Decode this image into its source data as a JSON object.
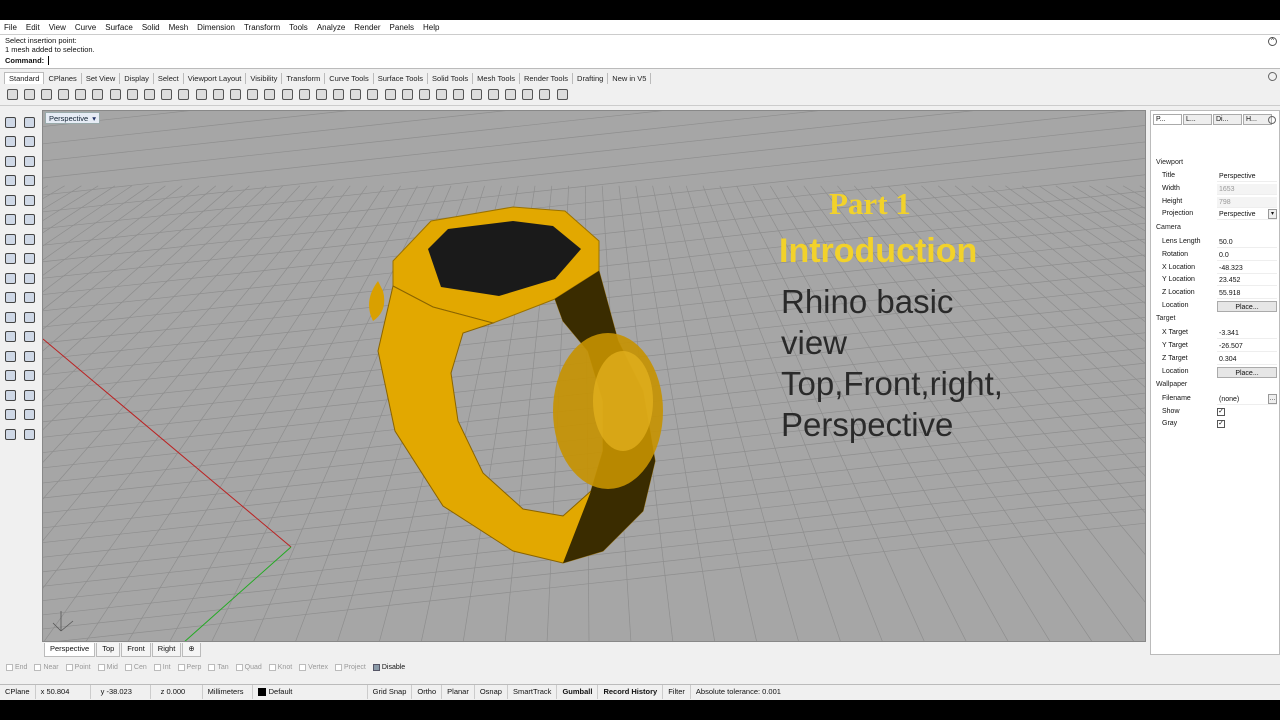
{
  "menu": [
    "File",
    "Edit",
    "View",
    "Curve",
    "Surface",
    "Solid",
    "Mesh",
    "Dimension",
    "Transform",
    "Tools",
    "Analyze",
    "Render",
    "Panels",
    "Help"
  ],
  "command": {
    "line1": "Select insertion point:",
    "line2": "1 mesh added to selection.",
    "prompt": "Command:"
  },
  "toolbar_tabs": [
    "Standard",
    "CPlanes",
    "Set View",
    "Display",
    "Select",
    "Viewport Layout",
    "Visibility",
    "Transform",
    "Curve Tools",
    "Surface Tools",
    "Solid Tools",
    "Mesh Tools",
    "Render Tools",
    "Drafting",
    "New in V5"
  ],
  "viewport": {
    "title": "Perspective",
    "dropdown_icon": "chevron-down-icon"
  },
  "overlay": {
    "part": "Part 1",
    "heading": "Introduction",
    "body_lines": [
      "Rhino basic",
      "view",
      "Top,Front,right,",
      "Perspective"
    ]
  },
  "viewport_tabs": [
    "Perspective",
    "Top",
    "Front",
    "Right"
  ],
  "osnaps": [
    {
      "label": "End",
      "on": false
    },
    {
      "label": "Near",
      "on": false
    },
    {
      "label": "Point",
      "on": false
    },
    {
      "label": "Mid",
      "on": false
    },
    {
      "label": "Cen",
      "on": false
    },
    {
      "label": "Int",
      "on": false
    },
    {
      "label": "Perp",
      "on": false
    },
    {
      "label": "Tan",
      "on": false
    },
    {
      "label": "Quad",
      "on": false
    },
    {
      "label": "Knot",
      "on": false
    },
    {
      "label": "Vertex",
      "on": false
    },
    {
      "label": "Project",
      "on": false
    },
    {
      "label": "Disable",
      "on": true
    }
  ],
  "status": {
    "cplane": "CPlane",
    "x": "x 50.804",
    "y": "y -38.023",
    "z": "z 0.000",
    "units": "Millimeters",
    "layer": "Default",
    "grid_snap": "Grid Snap",
    "ortho": "Ortho",
    "planar": "Planar",
    "osnap": "Osnap",
    "smarttrack": "SmartTrack",
    "gumball": "Gumball",
    "record": "Record History",
    "filter": "Filter",
    "tolerance": "Absolute tolerance: 0.001"
  },
  "panel": {
    "tabs": [
      "P...",
      "L...",
      "Di...",
      "H..."
    ],
    "viewport_section": "Viewport",
    "title": {
      "label": "Title",
      "value": "Perspective"
    },
    "width": {
      "label": "Width",
      "value": "1653"
    },
    "height": {
      "label": "Height",
      "value": "798"
    },
    "projection": {
      "label": "Projection",
      "value": "Perspective"
    },
    "camera_section": "Camera",
    "lens": {
      "label": "Lens Length",
      "value": "50.0"
    },
    "rotation": {
      "label": "Rotation",
      "value": "0.0"
    },
    "xloc": {
      "label": "X Location",
      "value": "-48.323"
    },
    "yloc": {
      "label": "Y Location",
      "value": "23.452"
    },
    "zloc": {
      "label": "Z Location",
      "value": "55.918"
    },
    "location": {
      "label": "Location",
      "value": "Place..."
    },
    "target_section": "Target",
    "xt": {
      "label": "X Target",
      "value": "-3.341"
    },
    "yt": {
      "label": "Y Target",
      "value": "-26.507"
    },
    "zt": {
      "label": "Z Target",
      "value": "0.304"
    },
    "tloc": {
      "label": "Location",
      "value": "Place..."
    },
    "wallpaper_section": "Wallpaper",
    "filename": {
      "label": "Filename",
      "value": "(none)"
    },
    "show": {
      "label": "Show",
      "checked": true
    },
    "gray": {
      "label": "Gray",
      "checked": true
    }
  },
  "colors": {
    "ring": "#e2a800",
    "overlay_yellow": "#f2d22a",
    "viewport_bg": "#a6a6a6"
  }
}
